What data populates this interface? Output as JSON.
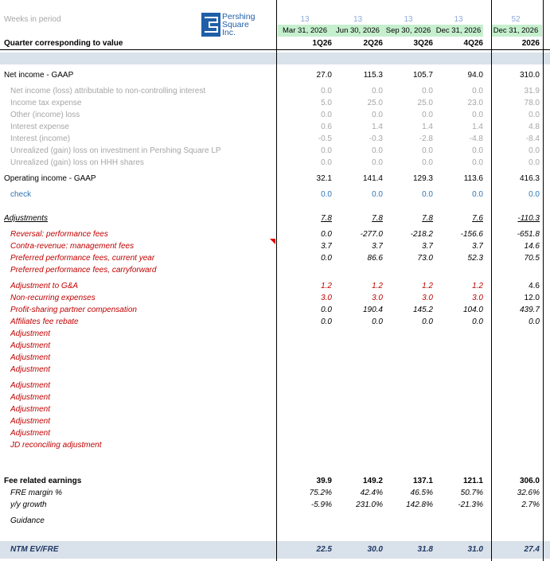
{
  "header": {
    "weeks_label": "Weeks in period",
    "weeks": [
      "13",
      "13",
      "13",
      "13",
      "52"
    ],
    "dates": [
      "Mar 31, 2026",
      "Jun 30, 2026",
      "Sep 30, 2026",
      "Dec 31, 2026",
      "Dec 31, 2026"
    ],
    "quarter_label": "Quarter corresponding to value",
    "quarters": [
      "1Q26",
      "2Q26",
      "3Q26",
      "4Q26",
      "2026"
    ],
    "logo": "Pershing Square Inc."
  },
  "rows": {
    "net_income": {
      "label": "Net income - GAAP",
      "values": [
        "27.0",
        "115.3",
        "105.7",
        "94.0",
        "310.0"
      ]
    },
    "nci": {
      "label": "Net income (loss) attributable to non-controlling interest",
      "values": [
        "0.0",
        "0.0",
        "0.0",
        "0.0",
        "31.9"
      ]
    },
    "tax": {
      "label": "Income tax expense",
      "values": [
        "5.0",
        "25.0",
        "25.0",
        "23.0",
        "78.0"
      ]
    },
    "other": {
      "label": "Other (income) loss",
      "values": [
        "0.0",
        "0.0",
        "0.0",
        "0.0",
        "0.0"
      ]
    },
    "int_exp": {
      "label": "Interest expense",
      "values": [
        "0.6",
        "1.4",
        "1.4",
        "1.4",
        "4.8"
      ]
    },
    "int_inc": {
      "label": "Interest (income)",
      "values": [
        "-0.5",
        "-0.3",
        "-2.8",
        "-4.8",
        "-8.4"
      ]
    },
    "unreal_psl": {
      "label": "Unrealized (gain) loss on investment in Pershing Square LP",
      "values": [
        "0.0",
        "0.0",
        "0.0",
        "0.0",
        "0.0"
      ]
    },
    "unreal_hhh": {
      "label": "Unrealized (gain) loss on HHH shares",
      "values": [
        "0.0",
        "0.0",
        "0.0",
        "0.0",
        "0.0"
      ]
    },
    "op_income": {
      "label": "Operating income - GAAP",
      "values": [
        "32.1",
        "141.4",
        "129.3",
        "113.6",
        "416.3"
      ]
    },
    "check": {
      "label": "check",
      "values": [
        "0.0",
        "0.0",
        "0.0",
        "0.0",
        "0.0"
      ]
    },
    "adjustments": {
      "label": "Adjustments",
      "values": [
        "7.8",
        "7.8",
        "7.8",
        "7.6",
        "-110.3"
      ]
    },
    "reversal": {
      "label": "Reversal: performance fees",
      "values": [
        "0.0",
        "-277.0",
        "-218.2",
        "-156.6",
        "-651.8"
      ]
    },
    "contra": {
      "label": "Contra-revenue: management fees",
      "values": [
        "3.7",
        "3.7",
        "3.7",
        "3.7",
        "14.6"
      ]
    },
    "pref_cur": {
      "label": "Preferred performance fees, current year",
      "values": [
        "0.0",
        "86.6",
        "73.0",
        "52.3",
        "70.5"
      ]
    },
    "pref_carry": {
      "label": "Preferred performance fees, carryforward",
      "values": [
        "",
        "",
        "",
        "",
        ""
      ]
    },
    "adj_ga": {
      "label": "Adjustment to G&A",
      "values": [
        "1.2",
        "1.2",
        "1.2",
        "1.2",
        "4.6"
      ]
    },
    "nonrec": {
      "label": "Non-recurring expenses",
      "values": [
        "3.0",
        "3.0",
        "3.0",
        "3.0",
        "12.0"
      ]
    },
    "profit_share": {
      "label": "Profit-sharing partner compensation",
      "values": [
        "0.0",
        "190.4",
        "145.2",
        "104.0",
        "439.7"
      ]
    },
    "affiliates": {
      "label": "Affiliates fee rebate",
      "values": [
        "0.0",
        "0.0",
        "0.0",
        "0.0",
        "0.0"
      ]
    },
    "adjustment_generic": "Adjustment",
    "jd": {
      "label": "JD reconciling adjustment"
    },
    "fre": {
      "label": "Fee related earnings",
      "values": [
        "39.9",
        "149.2",
        "137.1",
        "121.1",
        "306.0"
      ]
    },
    "fre_margin": {
      "label": "FRE margin %",
      "values": [
        "75.2%",
        "42.4%",
        "46.5%",
        "50.7%",
        "32.6%"
      ]
    },
    "yy": {
      "label": "y/y growth",
      "values": [
        "-5.9%",
        "231.0%",
        "142.8%",
        "-21.3%",
        "2.7%"
      ]
    },
    "guidance": {
      "label": "Guidance"
    },
    "ntm": {
      "label": "NTM EV/FRE",
      "values": [
        "22.5",
        "30.0",
        "31.8",
        "31.0",
        "27.4"
      ]
    }
  },
  "colors": {
    "accent_green": "#c6efce",
    "band_blue": "#d9e1ea",
    "adj_red": "#c00000",
    "check_blue": "#2f75b5",
    "ntm_navy": "#1f3864"
  }
}
